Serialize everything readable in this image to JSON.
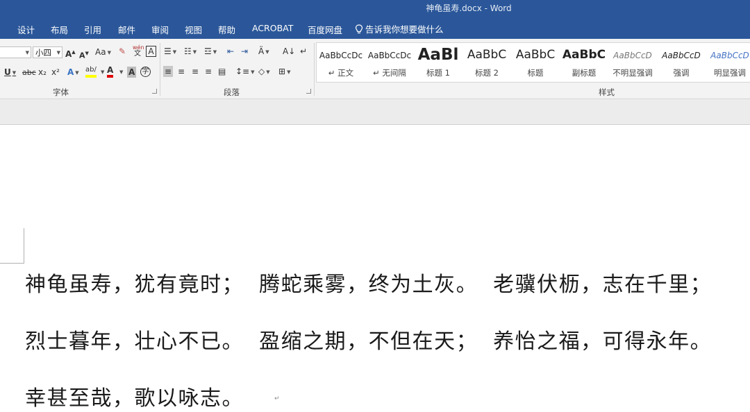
{
  "window": {
    "title": "神龟虽寿.docx  -  Word"
  },
  "tabs": [
    "设计",
    "布局",
    "引用",
    "邮件",
    "审阅",
    "视图",
    "帮助",
    "ACROBAT",
    "百度网盘"
  ],
  "tell_me": "告诉我你想要做什么",
  "font_group": {
    "label": "字体",
    "size_value": "小四",
    "change_case": "Aa",
    "phonetic": "wén 文",
    "strike": "abc",
    "subscript": "x₂",
    "superscript": "x²"
  },
  "paragraph_group": {
    "label": "段落"
  },
  "styles_group": {
    "label": "样式",
    "items": [
      {
        "preview": "AaBbCcDc",
        "name": "↵ 正文"
      },
      {
        "preview": "AaBbCcDc",
        "name": "↵ 无间隔"
      },
      {
        "preview": "AaBl",
        "name": "标题 1"
      },
      {
        "preview": "AaBbC",
        "name": "标题 2"
      },
      {
        "preview": "AaBbC",
        "name": "标题"
      },
      {
        "preview": "AaBbC",
        "name": "副标题"
      },
      {
        "preview": "AaBbCcD",
        "name": "不明显强调"
      },
      {
        "preview": "AaBbCcD",
        "name": "强调"
      },
      {
        "preview": "AaBbCcD",
        "name": "明显强调"
      }
    ]
  },
  "document": {
    "lines": [
      "神龟虽寿，犹有竟时；  腾蛇乘雾，终为土灰。  老骥伏枥，志在千里；",
      "烈士暮年，壮心不已。  盈缩之期，不但在天；  养怡之福，可得永年。",
      "幸甚至哉，歌以咏志。"
    ],
    "paragraph_mark": "↵"
  },
  "colors": {
    "accent": "#2b579a",
    "highlight": "#ffff00",
    "font_color": "#e00000"
  }
}
